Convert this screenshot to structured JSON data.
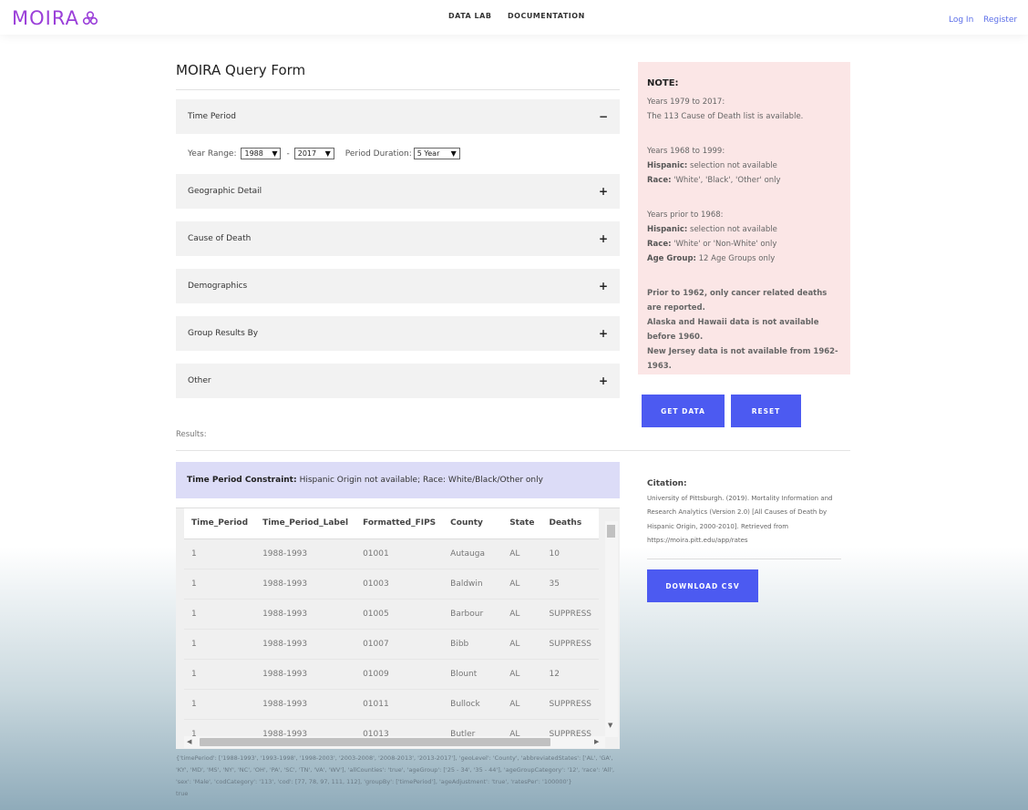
{
  "header": {
    "logo_text": "MOIRA",
    "nav": {
      "data_lab": "DATA LAB",
      "documentation": "DOCUMENTATION"
    },
    "auth": {
      "login": "Log In",
      "register": "Register"
    }
  },
  "form": {
    "title": "MOIRA Query Form",
    "sections": {
      "time_period": {
        "label": "Time Period",
        "sign": "−"
      },
      "geographic": {
        "label": "Geographic Detail",
        "sign": "+"
      },
      "cause": {
        "label": "Cause of Death",
        "sign": "+"
      },
      "demographics": {
        "label": "Demographics",
        "sign": "+"
      },
      "group_by": {
        "label": "Group Results By",
        "sign": "+"
      },
      "other": {
        "label": "Other",
        "sign": "+"
      }
    },
    "year_range": {
      "label": "Year Range:",
      "start": "1988",
      "separator": "-",
      "end": "2017",
      "duration_label": "Period Duration:",
      "duration": "5 Year"
    }
  },
  "note": {
    "title": "NOTE:",
    "block1": {
      "line1": "Years 1979 to 2017:",
      "line2": "The 113 Cause of Death list is available."
    },
    "block2": {
      "line1": "Years 1968 to 1999:",
      "hisp_label": "Hispanic:",
      "hisp_text": " selection not available",
      "race_label": "Race:",
      "race_text": " 'White', 'Black', 'Other' only"
    },
    "block3": {
      "line1": "Years prior to 1968:",
      "hisp_label": "Hispanic:",
      "hisp_text": " selection not available",
      "race_label": "Race:",
      "race_text": " 'White' or 'Non-White' only",
      "age_label": "Age Group:",
      "age_text": " 12 Age Groups only"
    },
    "block4": {
      "line1": "Prior to 1962, only cancer related deaths are reported.",
      "line2": "Alaska and Hawaii data is not available before 1960.",
      "line3": "New Jersey data is not available from 1962-1963."
    }
  },
  "buttons": {
    "get_data": "GET DATA",
    "reset": "RESET",
    "download": "DOWNLOAD CSV"
  },
  "results": {
    "label": "Results:",
    "constraint_label": "Time Period Constraint:",
    "constraint_text": "Hispanic Origin not available; Race: White/Black/Other only",
    "columns": [
      "Time_Period",
      "Time_Period_Label",
      "Formatted_FIPS",
      "County",
      "State",
      "Deaths"
    ],
    "rows": [
      [
        "1",
        "1988-1993",
        "01001",
        "Autauga",
        "AL",
        "10"
      ],
      [
        "1",
        "1988-1993",
        "01003",
        "Baldwin",
        "AL",
        "35"
      ],
      [
        "1",
        "1988-1993",
        "01005",
        "Barbour",
        "AL",
        "SUPPRESS"
      ],
      [
        "1",
        "1988-1993",
        "01007",
        "Bibb",
        "AL",
        "SUPPRESS"
      ],
      [
        "1",
        "1988-1993",
        "01009",
        "Blount",
        "AL",
        "12"
      ],
      [
        "1",
        "1988-1993",
        "01011",
        "Bullock",
        "AL",
        "SUPPRESS"
      ],
      [
        "1",
        "1988-1993",
        "01013",
        "Butler",
        "AL",
        "SUPPRESS"
      ]
    ]
  },
  "debug": {
    "line1": "{'timePeriod': ['1988-1993', '1993-1998', '1998-2003', '2003-2008', '2008-2013', '2013-2017'], 'geoLevel': 'County', 'abbreviatedStates': ['AL', 'GA',",
    "line2": "'KY', 'MD', 'MS', 'NY', 'NC', 'OH', 'PA', 'SC', 'TN', 'VA', 'WV'], 'allCounties': 'true', 'ageGroup': ['25 - 34', '35 - 44'], 'ageGroupCategory': '12', 'race': 'All',",
    "line3": "'sex': 'Male', 'codCategory': '113', 'cod': [77, 78, 97, 111, 112], 'groupBy': ['timePeriod'], 'ageAdjustment': 'true', 'ratesPer': '100000'}",
    "line4": "true"
  },
  "citation": {
    "title": "Citation:",
    "text": "University of Pittsburgh. (2019). Mortality Information and Research Analytics (Version 2.0) [All Causes of Death by Hispanic Origin, 2000-2010]. Retrieved from https://moira.pitt.edu/app/rates"
  },
  "colors": {
    "accent": "#4c5af1",
    "logo": "#9b3fd9",
    "note_bg": "#fbe6e6",
    "constraint_bg": "#dcdcf7"
  }
}
